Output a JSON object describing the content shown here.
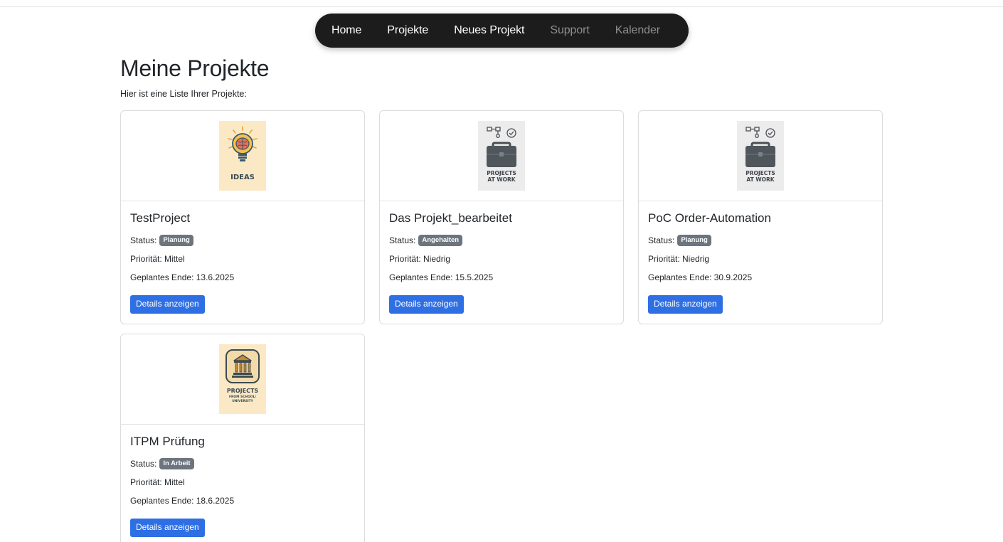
{
  "nav": {
    "items": [
      {
        "label": "Home",
        "active": true
      },
      {
        "label": "Projekte",
        "active": true
      },
      {
        "label": "Neues Projekt",
        "active": true
      },
      {
        "label": "Support",
        "active": false
      },
      {
        "label": "Kalender",
        "active": false
      }
    ]
  },
  "page": {
    "title": "Meine Projekte",
    "subtitle": "Hier ist eine Liste Ihrer Projekte:"
  },
  "labels": {
    "status": "Status:",
    "details_button": "Details anzeigen"
  },
  "projects": [
    {
      "name": "TestProject",
      "status": "Planung",
      "priority": "Priorität: Mittel",
      "end": "Geplantes Ende: 13.6.2025",
      "thumb": "ideas",
      "thumb_text": [
        "IDEAS"
      ]
    },
    {
      "name": "Das Projekt_bearbeitet",
      "status": "Angehalten",
      "priority": "Priorität: Niedrig",
      "end": "Geplantes Ende: 15.5.2025",
      "thumb": "work",
      "thumb_text": [
        "PROJECTS",
        "AT WORK"
      ]
    },
    {
      "name": "PoC Order-Automation",
      "status": "Planung",
      "priority": "Priorität: Niedrig",
      "end": "Geplantes Ende: 30.9.2025",
      "thumb": "work",
      "thumb_text": [
        "PROJECTS",
        "AT WORK"
      ]
    },
    {
      "name": "ITPM Prüfung",
      "status": "In Arbeit",
      "priority": "Priorität: Mittel",
      "end": "Geplantes Ende: 18.6.2025",
      "thumb": "school",
      "thumb_text": [
        "PROJECTS",
        "FROM SCHOOL/",
        "UNIVERSITY"
      ]
    }
  ],
  "colors": {
    "navbar_bg": "#1c1c1c",
    "badge_bg": "#6c757d",
    "button_bg": "#2f6fe4",
    "thumb_yellow": "#fbe9c6",
    "thumb_grey": "#ececec"
  },
  "icons": {
    "ideas": "lightbulb-brain-icon",
    "work": "briefcase-icon",
    "school": "university-building-icon"
  }
}
